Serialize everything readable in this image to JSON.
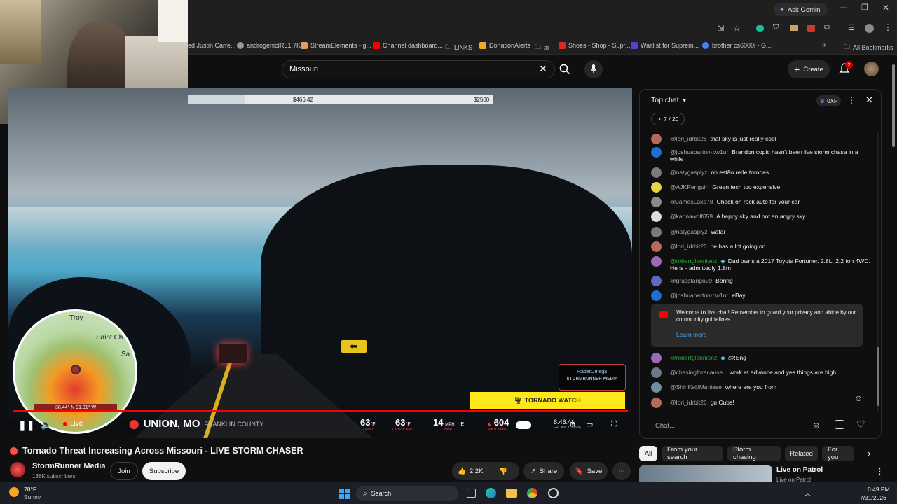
{
  "browser": {
    "ask_gemini": "Ask Gemini",
    "bookmarks": [
      {
        "label": "ed Justin Carre...",
        "color": "#888888"
      },
      {
        "label": "androgenicIRL1.7K",
        "color": "#c0c0c0"
      },
      {
        "label": "StreamElements - g...",
        "color": "#e0a060"
      },
      {
        "label": "Channel dashboard...",
        "color": "#ff0000"
      },
      {
        "label": "LINKS",
        "color": "#c8c8c8"
      },
      {
        "label": "DonationAlerts",
        "color": "#f5a623"
      },
      {
        "label": "ai",
        "color": "#c8c8c8"
      },
      {
        "label": "Shoes - Shop - Supr...",
        "color": "#d62b2b"
      },
      {
        "label": "Waitlist for Suprem...",
        "color": "#5a3fd6"
      },
      {
        "label": "brother cs6000i - G...",
        "color": "#4285f4"
      }
    ],
    "all_bookmarks": "All Bookmarks"
  },
  "youtube": {
    "search_value": "Missouri",
    "create_label": "Create",
    "notification_count": "2"
  },
  "video": {
    "donation_current": "$466.42",
    "donation_goal": "$2500",
    "map_labels": [
      "Troy",
      "Saint Ch",
      "Sa"
    ],
    "map_coords": "38.44° N 91.01° W",
    "live_label": "Live",
    "location": "UNION, MO",
    "county": "FRANKLIN COUNTY",
    "temp": "63",
    "temp_unit": "°F",
    "temp_label": "TEMP",
    "dewpoint": "63",
    "dewpoint_label": "DEWPOINT",
    "wind": "14",
    "wind_unit": "MPH",
    "wind_dir": "E",
    "wind_label": "WIND",
    "viewers": "604",
    "viewers_label": "WATCHING",
    "clock": "8:46:41",
    "date": "FRI JUL 31, 2026",
    "brand": "RadarOmega",
    "brand_sub": "STORMRUNNER MEDIA",
    "tornado_watch": "TORNADO WATCH",
    "title": "Tornado Threat Increasing Across Missouri - LIVE STORM CHASER",
    "channel": "StormRunner Media",
    "subscribers": "138K subscribers",
    "join": "Join",
    "subscribe": "Subscribe",
    "likes": "2.2K",
    "share": "Share",
    "save": "Save"
  },
  "chat": {
    "header": "Top chat",
    "xp": "0XP",
    "counter": "7 / 20",
    "messages": [
      {
        "author": "@lori_idrbit26",
        "text": "that sky is just really cool",
        "color": "#b56a5a",
        "green": false
      },
      {
        "author": "@joshuabarton-cw1ur",
        "text": "Brandon copic hasn't been live storm chase in a while",
        "color": "#1e6fd0",
        "green": false
      },
      {
        "author": "@natygasplyz",
        "text": "oh estão rede tornoes",
        "color": "#7a7a7a",
        "green": false
      },
      {
        "author": "@AJKPenguin",
        "text": "Green tech too expensive",
        "color": "#e7d44a",
        "green": false
      },
      {
        "author": "@JamesLake78",
        "text": "Check on rock auto for your car",
        "color": "#8a8a8a",
        "green": false
      },
      {
        "author": "@kannawolf659",
        "text": "A happy sky and not an angry sky",
        "color": "#dddddd",
        "green": false
      },
      {
        "author": "@natygasplyz",
        "text": "wafai",
        "color": "#7a7a7a",
        "green": false
      },
      {
        "author": "@lori_idrbit26",
        "text": "he has a lot going on",
        "color": "#b56a5a",
        "green": false
      },
      {
        "author": "@robertglennienz",
        "text": "Dad owns a 2017 Toyota Fortuner. 2.8L, 2.2 ton 4WD. He is - admittedly 1.8m",
        "color": "#9a6ab8",
        "green": true
      },
      {
        "author": "@grasstango29",
        "text": "Boring",
        "color": "#5c6bc0",
        "green": false
      },
      {
        "author": "@joshuabarton-cw1ur",
        "text": "eBay",
        "color": "#1e6fd0",
        "green": false
      }
    ],
    "welcome": "Welcome to live chat! Remember to guard your privacy and abide by our community guidelines.",
    "learn_more": "Learn more",
    "messages_after": [
      {
        "author": "@robertglennienz",
        "text": "@!Eng",
        "color": "#9a6ab8",
        "green": true
      },
      {
        "author": "@chasingforacause",
        "text": "I work at advance and yes things are high",
        "color": "#6a7a8a",
        "green": false
      },
      {
        "author": "@ShinKeijiManlese",
        "text": "where are you from",
        "color": "#6f8f9f",
        "green": false
      },
      {
        "author": "@lori_idrbit26",
        "text": "gn Cubs!",
        "color": "#b56a5a",
        "green": false
      }
    ],
    "input_placeholder": "Chat..."
  },
  "chips": [
    "All",
    "From your search",
    "Storm chasing",
    "Related",
    "For you"
  ],
  "recommended": {
    "title": "Live on Patrol",
    "channel": "Live on Patrol"
  },
  "taskbar": {
    "weather_temp": "78°F",
    "weather_desc": "Sunny",
    "search": "Search",
    "time": "6:49 PM",
    "date": "7/31/2026"
  }
}
